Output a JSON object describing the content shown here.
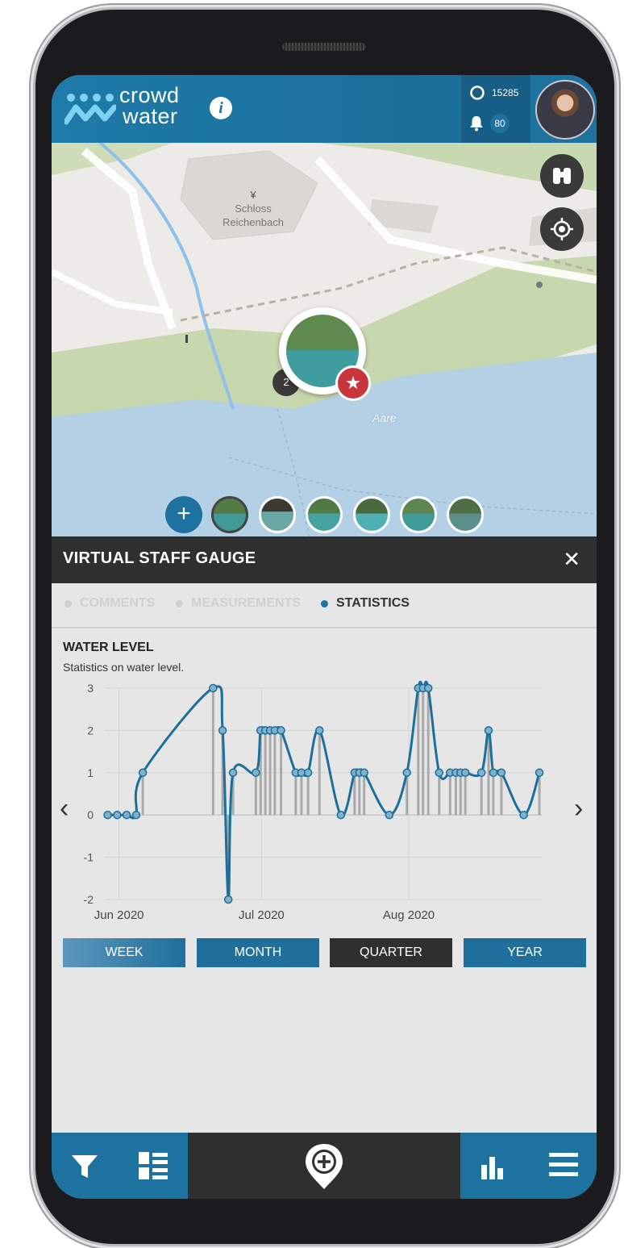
{
  "app": {
    "logo_line1": "crowd",
    "logo_line2": "water",
    "points": "15285",
    "notifications": "80"
  },
  "panel": {
    "title": "VIRTUAL STAFF GAUGE",
    "tabs": [
      {
        "label": "COMMENTS",
        "active": false
      },
      {
        "label": "MEASUREMENTS",
        "active": false
      },
      {
        "label": "STATISTICS",
        "active": true
      }
    ],
    "section_title": "WATER LEVEL",
    "section_subtitle": "Statistics on water level."
  },
  "map": {
    "place_label_line1": "Schloss",
    "place_label_line2": "Reichenbach",
    "river_label": "Aare",
    "cluster_count": "2",
    "thumbnail_count": 6
  },
  "chart_data": {
    "type": "line",
    "title": "WATER LEVEL",
    "xlabel": "",
    "ylabel": "",
    "ylim": [
      -2,
      3
    ],
    "yticks": [
      3,
      2,
      1,
      0,
      -1,
      -2
    ],
    "xtick_labels": [
      {
        "label": "Jun 2020",
        "day": 0
      },
      {
        "label": "Jul 2020",
        "day": 30
      },
      {
        "label": "Aug 2020",
        "day": 61
      }
    ],
    "x_unit": "days from 2020-06-01",
    "series": [
      {
        "points": [
          [
            -2.4,
            0
          ],
          [
            -0.4,
            0
          ],
          [
            1.6,
            0
          ],
          [
            3.6,
            0
          ],
          [
            5.0,
            1
          ],
          [
            19.8,
            3
          ],
          [
            21.8,
            2
          ],
          [
            23.0,
            -2
          ],
          [
            24.0,
            1
          ],
          [
            28.8,
            1
          ],
          [
            29.8,
            2
          ],
          [
            30.8,
            2
          ],
          [
            31.8,
            2
          ],
          [
            32.8,
            2
          ],
          [
            34.1,
            2
          ],
          [
            37.2,
            1
          ],
          [
            38.4,
            1
          ],
          [
            39.8,
            1
          ],
          [
            42.2,
            2
          ],
          [
            46.7,
            0
          ],
          [
            49.6,
            1
          ],
          [
            50.6,
            1
          ],
          [
            51.6,
            1
          ],
          [
            56.9,
            0
          ],
          [
            60.6,
            1
          ],
          [
            63.0,
            3
          ],
          [
            64.0,
            3
          ],
          [
            65.1,
            3
          ],
          [
            67.4,
            1
          ],
          [
            69.7,
            1
          ],
          [
            70.9,
            1
          ],
          [
            71.9,
            1
          ],
          [
            72.9,
            1
          ],
          [
            76.3,
            1
          ],
          [
            77.8,
            2
          ],
          [
            78.8,
            1
          ],
          [
            80.5,
            1
          ],
          [
            85.2,
            0
          ],
          [
            88.5,
            1
          ]
        ]
      }
    ],
    "grid": true
  },
  "chart_nav": {
    "prev": "‹",
    "next": "›"
  },
  "ranges": [
    {
      "label": "WEEK",
      "active": false
    },
    {
      "label": "MONTH",
      "active": false
    },
    {
      "label": "QUARTER",
      "active": true
    },
    {
      "label": "YEAR",
      "active": false
    }
  ],
  "colors": {
    "brand": "#1e72a0",
    "dark": "#2f2f2f",
    "line": "#1b6f9a",
    "point": "#7eb3cf"
  },
  "icons": {
    "binoculars": "binoculars-icon",
    "locate": "locate-icon",
    "filter": "filter-icon",
    "list": "list-icon",
    "add_location": "add-location-icon",
    "stats": "bar-chart-icon",
    "menu": "menu-icon"
  }
}
